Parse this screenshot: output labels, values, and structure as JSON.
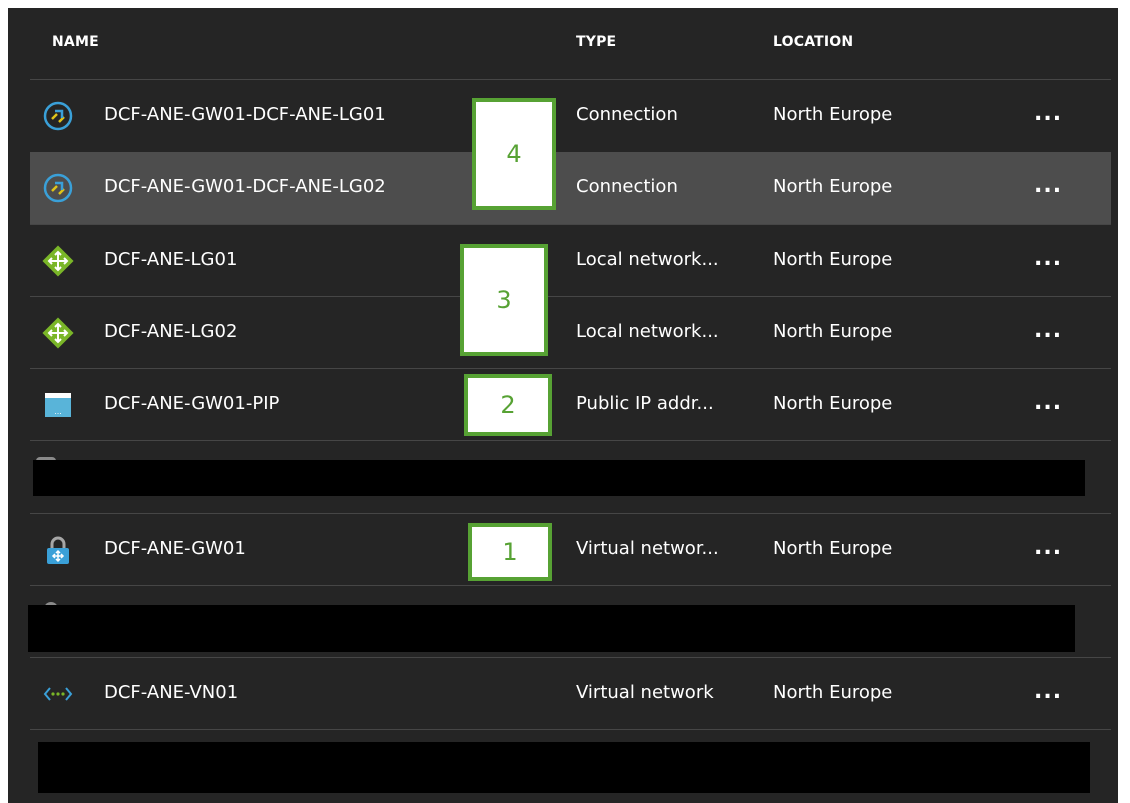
{
  "columns": {
    "name": "NAME",
    "type": "TYPE",
    "location": "LOCATION"
  },
  "rows": [
    {
      "name": "DCF-ANE-GW01-DCF-ANE-LG01",
      "type": "Connection",
      "location": "North Europe",
      "icon": "connection-icon",
      "more": "..."
    },
    {
      "name": "DCF-ANE-GW01-DCF-ANE-LG02",
      "type": "Connection",
      "location": "North Europe",
      "icon": "connection-icon",
      "more": "...",
      "selected": true
    },
    {
      "name": "DCF-ANE-LG01",
      "type": "Local network...",
      "location": "North Europe",
      "icon": "local-network-gateway-icon",
      "more": "..."
    },
    {
      "name": "DCF-ANE-LG02",
      "type": "Local network...",
      "location": "North Europe",
      "icon": "local-network-gateway-icon",
      "more": "..."
    },
    {
      "name": "DCF-ANE-GW01-PIP",
      "type": "Public IP addr...",
      "location": "North Europe",
      "icon": "public-ip-icon",
      "more": "..."
    },
    {
      "name": "DCF-ANE-GW01",
      "type": "Virtual networ...",
      "location": "North Europe",
      "icon": "virtual-network-gateway-icon",
      "more": "..."
    },
    {
      "name": "DCF-ANE-VN01",
      "type": "Virtual network",
      "location": "North Europe",
      "icon": "virtual-network-icon",
      "more": "..."
    }
  ],
  "callouts": [
    "4",
    "3",
    "2",
    "1"
  ],
  "colors": {
    "background": "#252525",
    "selected_row": "#4d4d4d",
    "callout_border": "#57a234",
    "divider": "#464646"
  }
}
